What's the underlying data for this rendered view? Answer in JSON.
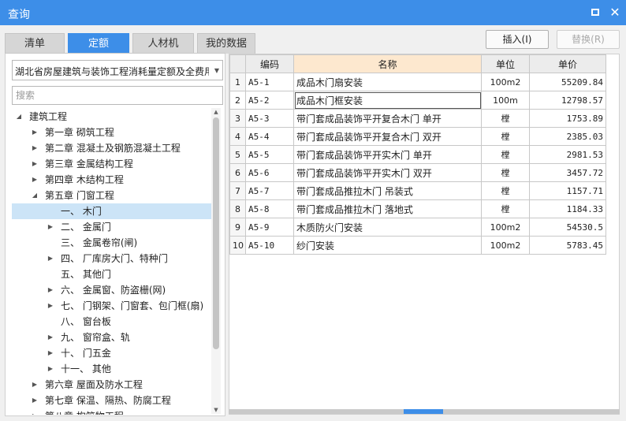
{
  "window": {
    "title": "查询",
    "maximize_label": "",
    "close_label": "✕"
  },
  "tabs": [
    {
      "label": "清单"
    },
    {
      "label": "定额"
    },
    {
      "label": "人材机"
    },
    {
      "label": "我的数据"
    }
  ],
  "left": {
    "library_select": "湖北省房屋建筑与装饰工程消耗量定额及全费用",
    "search_placeholder": "搜索",
    "tree": [
      {
        "label": "建筑工程",
        "toggle": "◢"
      },
      {
        "label": "第一章 砌筑工程",
        "toggle": "▶"
      },
      {
        "label": "第二章 混凝土及钢筋混凝土工程",
        "toggle": "▶"
      },
      {
        "label": "第三章 金属结构工程",
        "toggle": "▶"
      },
      {
        "label": "第四章 木结构工程",
        "toggle": "▶"
      },
      {
        "label": "第五章 门窗工程",
        "toggle": "◢"
      },
      {
        "label": "一、 木门",
        "toggle": ""
      },
      {
        "label": "二、 金属门",
        "toggle": "▶"
      },
      {
        "label": "三、 金属卷帘(闸)",
        "toggle": ""
      },
      {
        "label": "四、 厂库房大门、特种门",
        "toggle": "▶"
      },
      {
        "label": "五、 其他门",
        "toggle": ""
      },
      {
        "label": "六、 金属窗、防盗栅(网)",
        "toggle": "▶"
      },
      {
        "label": "七、 门钢架、门窗套、包门框(扇)",
        "toggle": "▶"
      },
      {
        "label": "八、 窗台板",
        "toggle": ""
      },
      {
        "label": "九、 窗帘盒、轨",
        "toggle": "▶"
      },
      {
        "label": "十、 门五金",
        "toggle": "▶"
      },
      {
        "label": "十一、 其他",
        "toggle": "▶"
      },
      {
        "label": "第六章 屋面及防水工程",
        "toggle": "▶"
      },
      {
        "label": "第七章 保温、隔热、防腐工程",
        "toggle": "▶"
      },
      {
        "label": "第八章 构筑物工程",
        "toggle": "▶"
      }
    ],
    "scroll_up": "▲",
    "scroll_down": "▼"
  },
  "actions": {
    "insert_label": "插入(I)",
    "replace_label": "替换(R)"
  },
  "grid": {
    "headers": {
      "rownum": "",
      "code": "编码",
      "name": "名称",
      "unit": "单位",
      "price": "单价"
    },
    "rows": [
      {
        "n": "1",
        "code": "A5-1",
        "name": "成品木门扇安装",
        "unit": "100m2",
        "price": "55209.84"
      },
      {
        "n": "2",
        "code": "A5-2",
        "name": "成品木门框安装",
        "unit": "100m",
        "price": "12798.57"
      },
      {
        "n": "3",
        "code": "A5-3",
        "name": "带门套成品装饰平开复合木门 单开",
        "unit": "樘",
        "price": "1753.89"
      },
      {
        "n": "4",
        "code": "A5-4",
        "name": "带门套成品装饰平开复合木门 双开",
        "unit": "樘",
        "price": "2385.03"
      },
      {
        "n": "5",
        "code": "A5-5",
        "name": "带门套成品装饰平开实木门 单开",
        "unit": "樘",
        "price": "2981.53"
      },
      {
        "n": "6",
        "code": "A5-6",
        "name": "带门套成品装饰平开实木门 双开",
        "unit": "樘",
        "price": "3457.72"
      },
      {
        "n": "7",
        "code": "A5-7",
        "name": "带门套成品推拉木门 吊装式",
        "unit": "樘",
        "price": "1157.71"
      },
      {
        "n": "8",
        "code": "A5-8",
        "name": "带门套成品推拉木门 落地式",
        "unit": "樘",
        "price": "1184.33"
      },
      {
        "n": "9",
        "code": "A5-9",
        "name": "木质防火门安装",
        "unit": "100m2",
        "price": "54530.5"
      },
      {
        "n": "10",
        "code": "A5-10",
        "name": "纱门安装",
        "unit": "100m2",
        "price": "5783.45"
      }
    ]
  },
  "colors": {
    "accent": "#3d8ee8",
    "header_highlight": "#fde8cf",
    "selection": "#cce4f7"
  }
}
